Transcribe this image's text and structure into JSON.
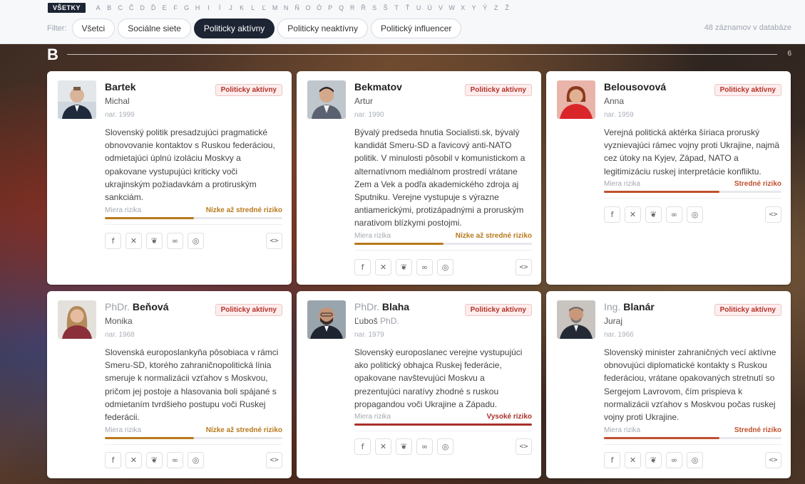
{
  "alphabet": {
    "all_label": "VŠETKY",
    "letters": [
      "A",
      "B",
      "C",
      "Č",
      "D",
      "Ď",
      "E",
      "F",
      "G",
      "H",
      "I",
      "Í",
      "J",
      "K",
      "L",
      "Ľ",
      "M",
      "N",
      "Ň",
      "O",
      "Ó",
      "P",
      "Q",
      "R",
      "Ř",
      "S",
      "Š",
      "T",
      "Ť",
      "U",
      "Ú",
      "V",
      "W",
      "X",
      "Y",
      "Ý",
      "Z",
      "Ž"
    ]
  },
  "filters": {
    "label": "Filter:",
    "options": [
      "Všetci",
      "Sociálne siete",
      "Politicky aktívny",
      "Politicky neaktívny",
      "Politický influencer"
    ],
    "active": "Politicky aktívny"
  },
  "record_count": "48 záznamov v databáze",
  "section": {
    "letter": "B",
    "count": "6"
  },
  "risk_label": "Miera rizika",
  "icons": [
    "facebook-icon",
    "x-icon",
    "bluesky-icon",
    "link-icon",
    "globe-icon"
  ],
  "embed_icon": "code-icon",
  "cards": [
    {
      "prefix": "",
      "surname": "Bartek",
      "first_name": "Michal",
      "suffix": "",
      "born": "nar. 1999",
      "status": "Politicky aktívny",
      "description": "Slovenský politik presadzujúci pragmatické obnovovanie kontaktov s Ruskou federáciou, odmietajúci úplnú izoláciu Moskvy a opakovane vystupujúci kriticky voči ukrajinským požiadavkám a protiruským sankciám.",
      "risk": "Nízke až stredné riziko",
      "risk_level": 0.5,
      "risk_color": "#b87a1d"
    },
    {
      "prefix": "",
      "surname": "Bekmatov",
      "first_name": "Artur",
      "suffix": "",
      "born": "nar. 1990",
      "status": "Politicky aktívny",
      "description": "Bývalý predseda hnutia Socialisti.sk, bývalý kandidát Smeru-SD a ľavicový anti-NATO politik. V minulosti pôsobil v komunistickom a alternatívnom mediálnom prostredí vrátane Zem a Vek a podľa akademického zdroja aj Sputniku. Verejne vystupuje s výrazne antiamerickými, protizápadnými a proruským narativom blízkymi postojmi.",
      "risk": "Nízke až stredné riziko",
      "risk_level": 0.5,
      "risk_color": "#b87a1d"
    },
    {
      "prefix": "",
      "surname": "Belousovová",
      "first_name": "Anna",
      "suffix": "",
      "born": "nar. 1959",
      "status": "Politicky aktívny",
      "description": "Verejná politická aktérka šíriaca proruský vyznievajúci rámec vojny proti Ukrajine, najmä cez útoky na Kyjev, Západ, NATO a legitimizáciu ruskej interpretácie konfliktu.",
      "risk": "Stredné riziko",
      "risk_level": 0.65,
      "risk_color": "#c0502e"
    },
    {
      "prefix": "PhDr.",
      "surname": "Beňová",
      "first_name": "Monika",
      "suffix": "",
      "born": "nar. 1968",
      "status": "Politicky aktívny",
      "description": "Slovenská europoslankyňa pôsobiaca v rámci Smeru-SD, ktorého zahraničnopolitická línia smeruje k normalizácii vzťahov s Moskvou, pričom jej postoje a hlasovania boli spájané s odmietaním tvrdšieho postupu voči Ruskej federácii.",
      "risk": "Nízke až stredné riziko",
      "risk_level": 0.5,
      "risk_color": "#b87a1d"
    },
    {
      "prefix": "PhDr.",
      "surname": "Blaha",
      "first_name": "Ľuboš",
      "suffix": "PhD.",
      "born": "nar. 1979",
      "status": "Politicky aktívny",
      "description": "Slovenský europoslanec verejne vystupujúci ako politický obhajca Ruskej federácie, opakovane navštevujúci Moskvu a prezentujúci naratívy zhodné s ruskou propagandou voči Ukrajine a Západu.",
      "risk": "Vysoké riziko",
      "risk_level": 1.0,
      "risk_color": "#a8302b"
    },
    {
      "prefix": "Ing.",
      "surname": "Blanár",
      "first_name": "Juraj",
      "suffix": "",
      "born": "nar. 1966",
      "status": "Politicky aktívny",
      "description": "Slovenský minister zahraničných vecí aktívne obnovujúci diplomatické kontakty s Ruskou federáciou, vrátane opakovaných stretnutí so Sergejom Lavrovom, čím prispieva k normalizácii vzťahov s Moskvou počas ruskej vojny proti Ukrajine.",
      "risk": "Stredné riziko",
      "risk_level": 0.65,
      "risk_color": "#c0502e"
    }
  ]
}
